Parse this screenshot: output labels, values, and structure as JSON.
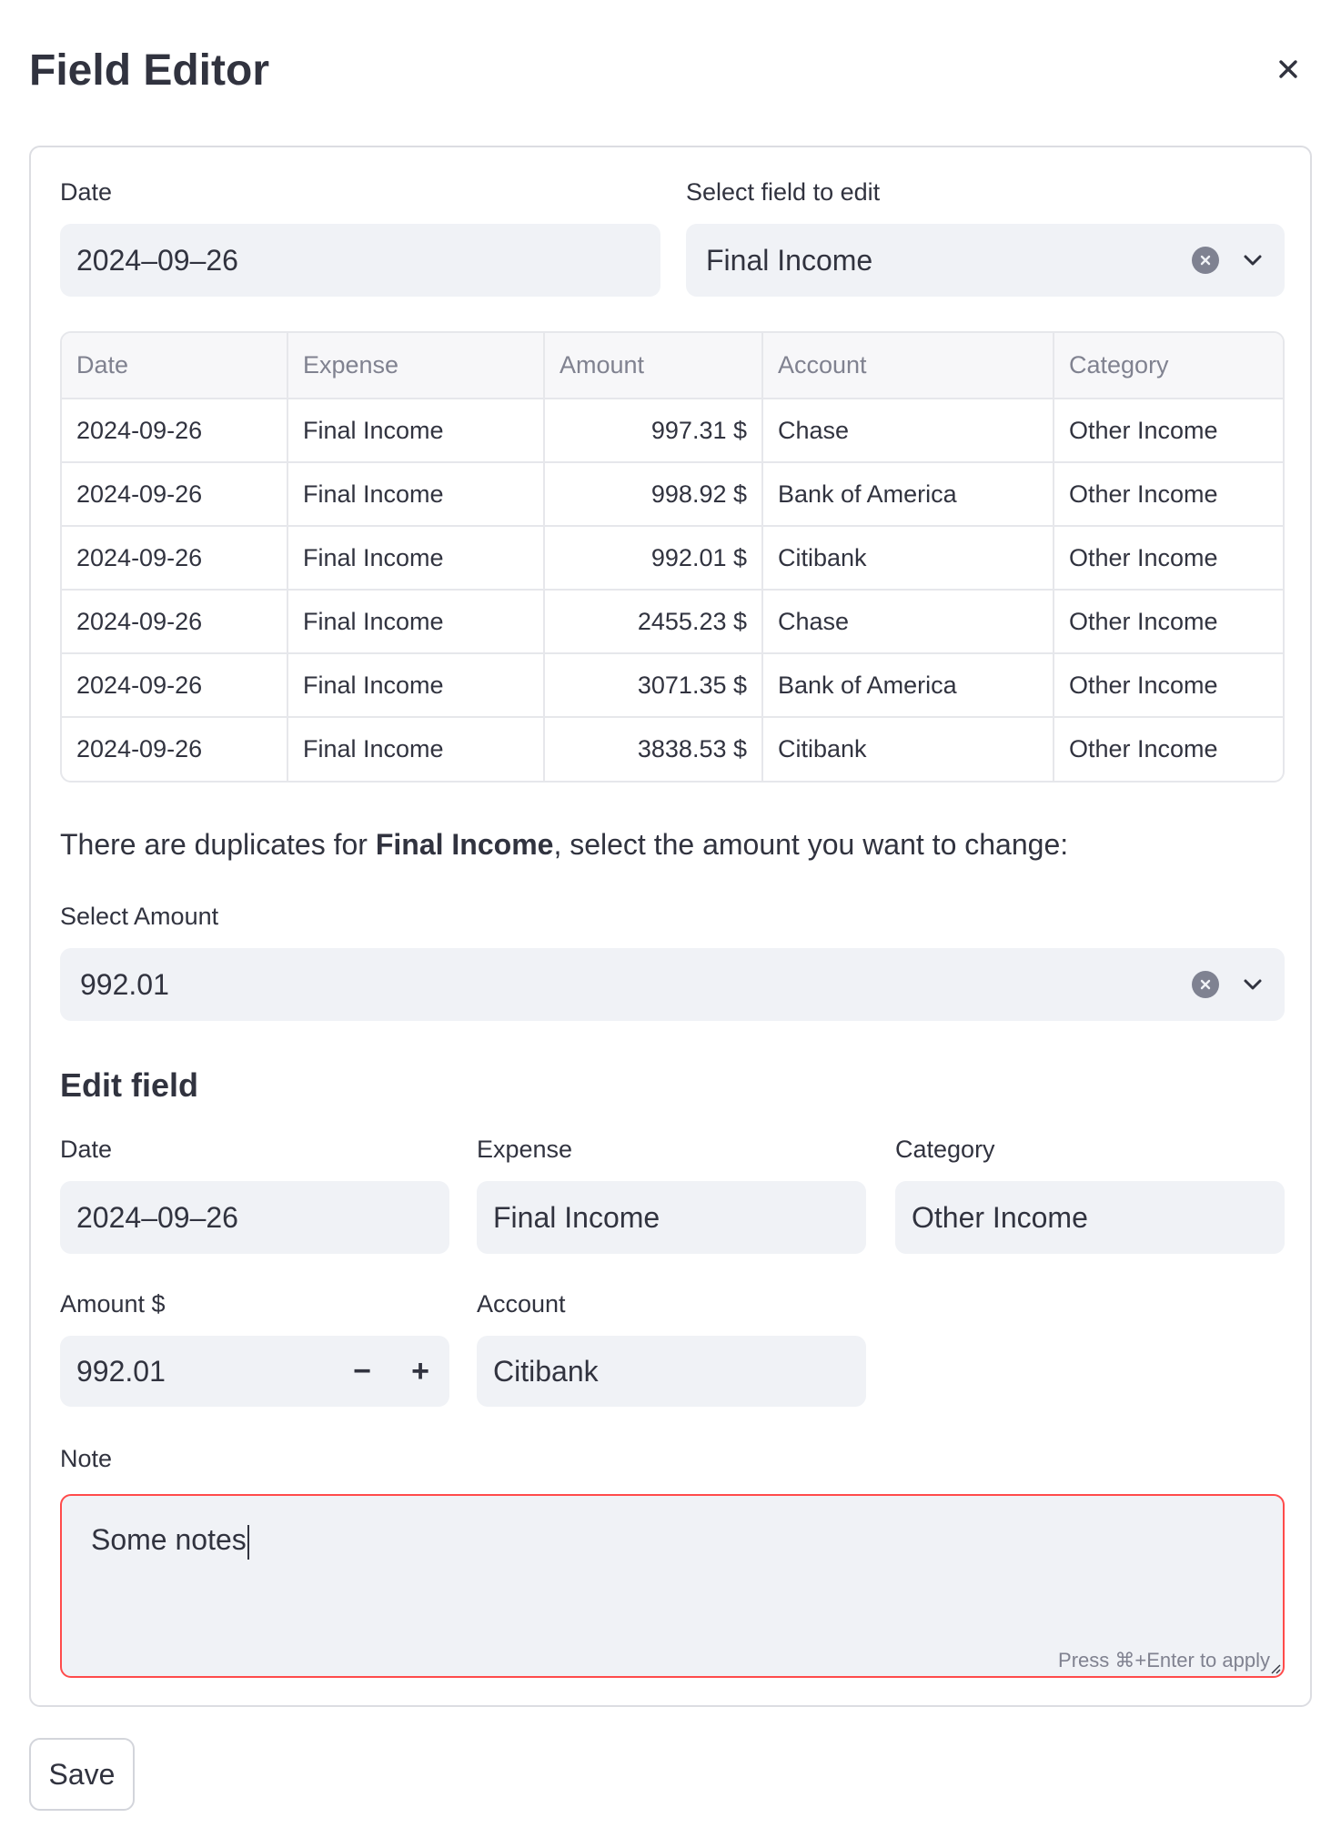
{
  "dialog": {
    "title": "Field Editor",
    "close_icon": "close-icon"
  },
  "top": {
    "date_label": "Date",
    "date_value": "2024–09–26",
    "select_field_label": "Select field to edit",
    "select_field_value": "Final Income"
  },
  "table": {
    "columns": [
      "Date",
      "Expense",
      "Amount",
      "Account",
      "Category"
    ],
    "rows": [
      [
        "2024-09-26",
        "Final Income",
        "997.31 $",
        "Chase",
        "Other Income"
      ],
      [
        "2024-09-26",
        "Final Income",
        "998.92 $",
        "Bank of America",
        "Other Income"
      ],
      [
        "2024-09-26",
        "Final Income",
        "992.01 $",
        "Citibank",
        "Other Income"
      ],
      [
        "2024-09-26",
        "Final Income",
        "2455.23 $",
        "Chase",
        "Other Income"
      ],
      [
        "2024-09-26",
        "Final Income",
        "3071.35 $",
        "Bank of America",
        "Other Income"
      ],
      [
        "2024-09-26",
        "Final Income",
        "3838.53 $",
        "Citibank",
        "Other Income"
      ]
    ]
  },
  "duplicates": {
    "prefix": "There are duplicates for ",
    "name": "Final Income",
    "suffix": ", select the amount you want to change:"
  },
  "select_amount": {
    "label": "Select Amount",
    "value": "992.01"
  },
  "edit": {
    "title": "Edit field",
    "date_label": "Date",
    "date_value": "2024–09–26",
    "expense_label": "Expense",
    "expense_value": "Final Income",
    "category_label": "Category",
    "category_value": "Other Income",
    "amount_label": "Amount $",
    "amount_value": "992.01",
    "minus": "−",
    "plus": "+",
    "account_label": "Account",
    "account_value": "Citibank",
    "note_label": "Note",
    "note_value": "Some notes",
    "note_hint": "Press ⌘+Enter to apply"
  },
  "save_label": "Save",
  "colors": {
    "accent_error": "#ff4b4b",
    "field_bg": "#f0f2f6",
    "text": "#31333f"
  }
}
